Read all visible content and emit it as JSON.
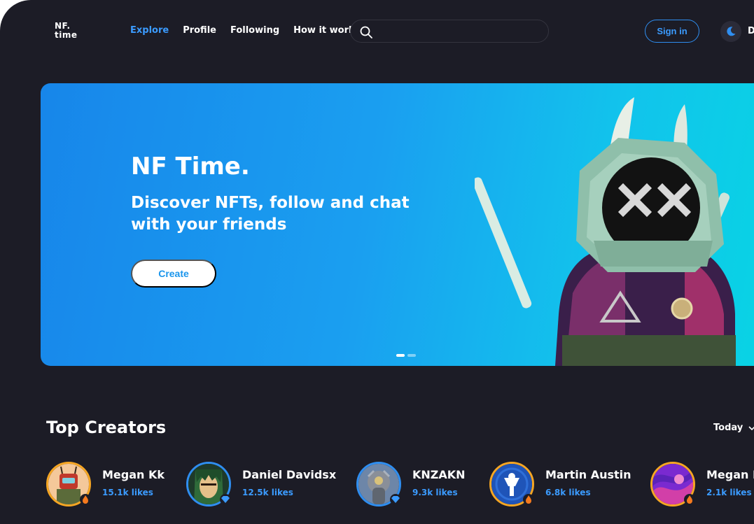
{
  "header": {
    "logo_line1": "NF.",
    "logo_line2": "time",
    "nav": [
      "Explore",
      "Profile",
      "Following",
      "How it works"
    ],
    "search_placeholder": "",
    "signin_label": "Sign in",
    "theme_label": "D"
  },
  "hero": {
    "title": "NF Time.",
    "subtitle": "Discover NFTs, follow and chat with your friends",
    "cta_label": "Create",
    "slides": 2,
    "active_slide": 1
  },
  "creators_section": {
    "title": "Top Creators",
    "period": "Today"
  },
  "creators": [
    {
      "name": "Megan Kk",
      "likes": "15.1k likes",
      "ring": "orange",
      "badge": "flame-icon"
    },
    {
      "name": "Daniel Davidsx",
      "likes": "12.5k likes",
      "ring": "blue",
      "badge": "diamond-icon"
    },
    {
      "name": "KNZAKN",
      "likes": "9.3k likes",
      "ring": "blue",
      "badge": "diamond-icon"
    },
    {
      "name": "Martin Austin",
      "likes": "6.8k likes",
      "ring": "orange",
      "badge": "flame-icon"
    },
    {
      "name": "Megan Kk",
      "likes": "2.1k likes",
      "ring": "orange",
      "badge": "flame-icon"
    }
  ],
  "colors": {
    "background": "#1c1c26",
    "accent": "#3b9bff",
    "hero_start": "#1786ea",
    "hero_end": "#08d4e4",
    "ring_orange": "#f6a623",
    "ring_blue": "#2f8ef0"
  }
}
